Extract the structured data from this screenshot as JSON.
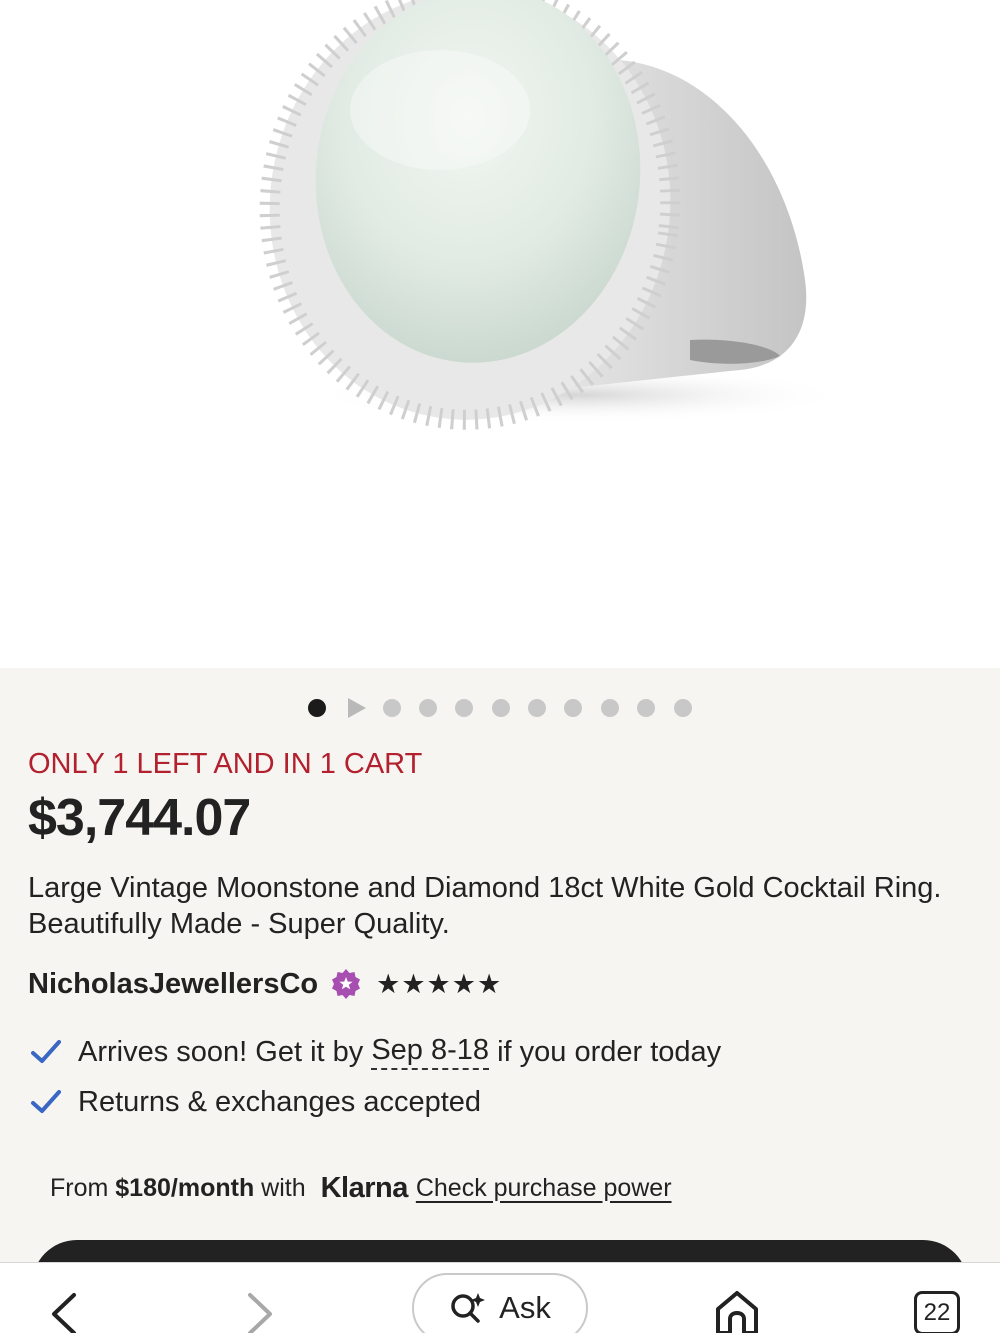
{
  "product": {
    "image_alt": "Large vintage moonstone and diamond white gold cocktail ring",
    "stock_notice": "ONLY 1 LEFT AND IN 1 CART",
    "price": "$3,744.07",
    "title": "Large Vintage Moonstone and Diamond 18ct White Gold Cocktail Ring. Beautifully Made - Super Quality."
  },
  "gallery": {
    "total_dots": 10,
    "active_index": 0
  },
  "seller": {
    "name": "NicholasJewellersCo",
    "badge_icon": "star-seller-icon",
    "rating": 5,
    "stars_text": "★★★★★"
  },
  "perks": {
    "arrival_prefix": "Arrives soon! Get it by ",
    "arrival_date": "Sep 8-18",
    "arrival_suffix": " if you order today",
    "returns": "Returns & exchanges accepted"
  },
  "financing": {
    "prefix": "From ",
    "amount": "$180/month",
    "middle": " with ",
    "brand": "Klarna",
    "link": "Check purchase power"
  },
  "bottom_nav": {
    "ask_label": "Ask",
    "tab_count": "22"
  },
  "colors": {
    "stock_red": "#b3202e",
    "check_blue": "#3a66c4",
    "star_seller_purple": "#a64fb0",
    "background": "#f6f5f2"
  }
}
